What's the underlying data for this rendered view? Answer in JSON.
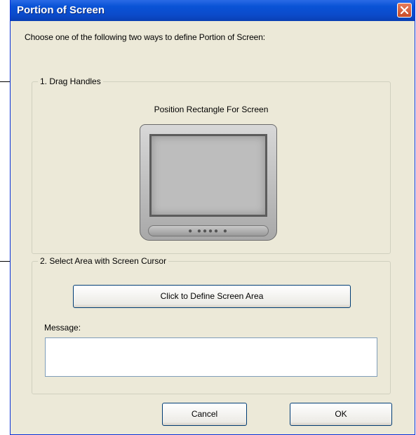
{
  "window": {
    "title": "Portion of Screen"
  },
  "instruction": "Choose one of the following two ways to define Portion of Screen:",
  "group1": {
    "label": "1. Drag Handles",
    "rect_label": "Position Rectangle For Screen"
  },
  "group2": {
    "label": "2. Select Area with Screen Cursor",
    "define_button": "Click to Define Screen Area",
    "message_label": "Message:",
    "message_value": ""
  },
  "buttons": {
    "cancel": "Cancel",
    "ok": "OK"
  },
  "colors": {
    "titlebar": "#0a53d6",
    "dialog_bg": "#ece9d8",
    "close_button": "#d45a36"
  }
}
